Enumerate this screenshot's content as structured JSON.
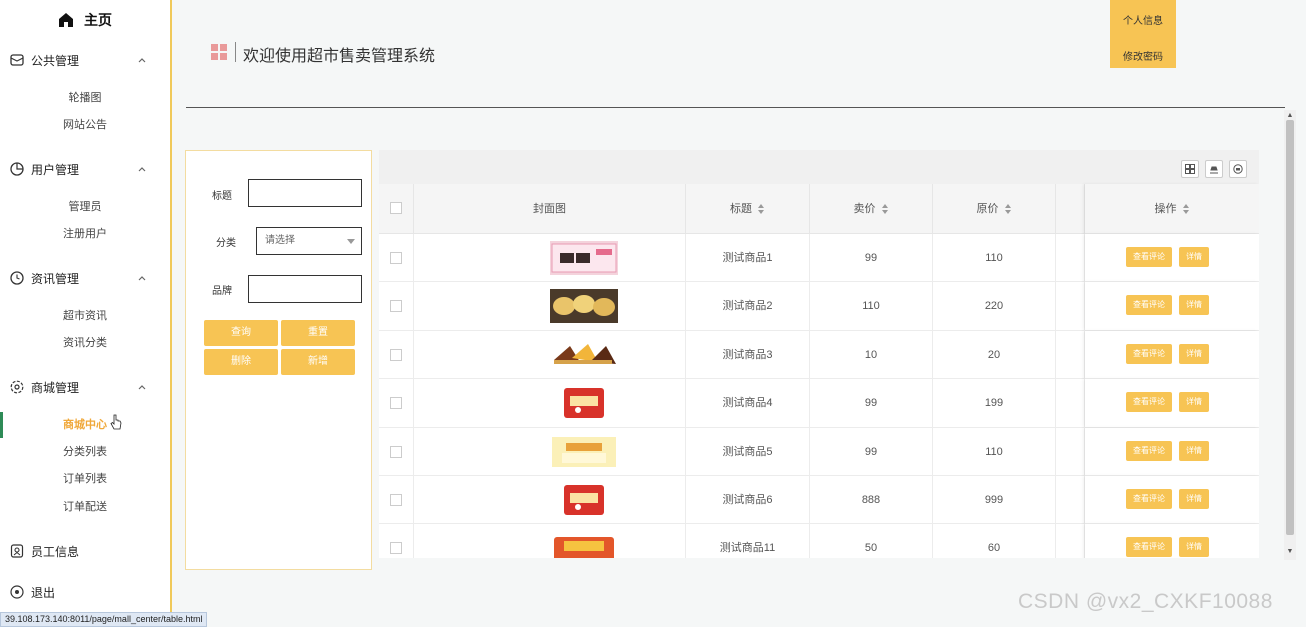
{
  "sidebar": {
    "home_label": "主页",
    "groups": [
      {
        "label": "公共管理",
        "icon": "mail-icon",
        "items": [
          "轮播图",
          "网站公告"
        ]
      },
      {
        "label": "用户管理",
        "icon": "pie-icon",
        "items": [
          "管理员",
          "注册用户"
        ]
      },
      {
        "label": "资讯管理",
        "icon": "clock-icon",
        "items": [
          "超市资讯",
          "资讯分类"
        ]
      },
      {
        "label": "商城管理",
        "icon": "flower-icon",
        "items": [
          "商城中心",
          "分类列表",
          "订单列表",
          "订单配送"
        ]
      }
    ],
    "staff_label": "员工信息",
    "logout_label": "退出",
    "active_item": "商城中心"
  },
  "header": {
    "title": "欢迎使用超市售卖管理系统",
    "user_menu": [
      "个人信息",
      "修改密码"
    ]
  },
  "search": {
    "title_label": "标题",
    "category_label": "分类",
    "category_placeholder": "请选择",
    "brand_label": "品牌",
    "query_btn": "查询",
    "reset_btn": "重置",
    "delete_btn": "删除",
    "add_btn": "新增"
  },
  "table": {
    "columns": [
      "封面图",
      "标题",
      "卖价",
      "原价",
      "操作"
    ],
    "rows": [
      {
        "title": "测试商品1",
        "price": "99",
        "original": "110"
      },
      {
        "title": "测试商品2",
        "price": "110",
        "original": "220"
      },
      {
        "title": "测试商品3",
        "price": "10",
        "original": "20"
      },
      {
        "title": "测试商品4",
        "price": "99",
        "original": "199"
      },
      {
        "title": "测试商品5",
        "price": "99",
        "original": "110"
      },
      {
        "title": "测试商品6",
        "price": "888",
        "original": "999"
      },
      {
        "title": "测试商品11",
        "price": "50",
        "original": "60"
      }
    ],
    "view_review_btn": "查看评论",
    "detail_btn": "详情"
  },
  "status_url": "39.108.173.140:8011/page/mall_center/table.html",
  "watermark": "CSDN @vx2_CXKF10088",
  "colors": {
    "accent": "#f7c454",
    "active_text": "#f0a83a",
    "sidebar_border": "#f0c95a"
  }
}
